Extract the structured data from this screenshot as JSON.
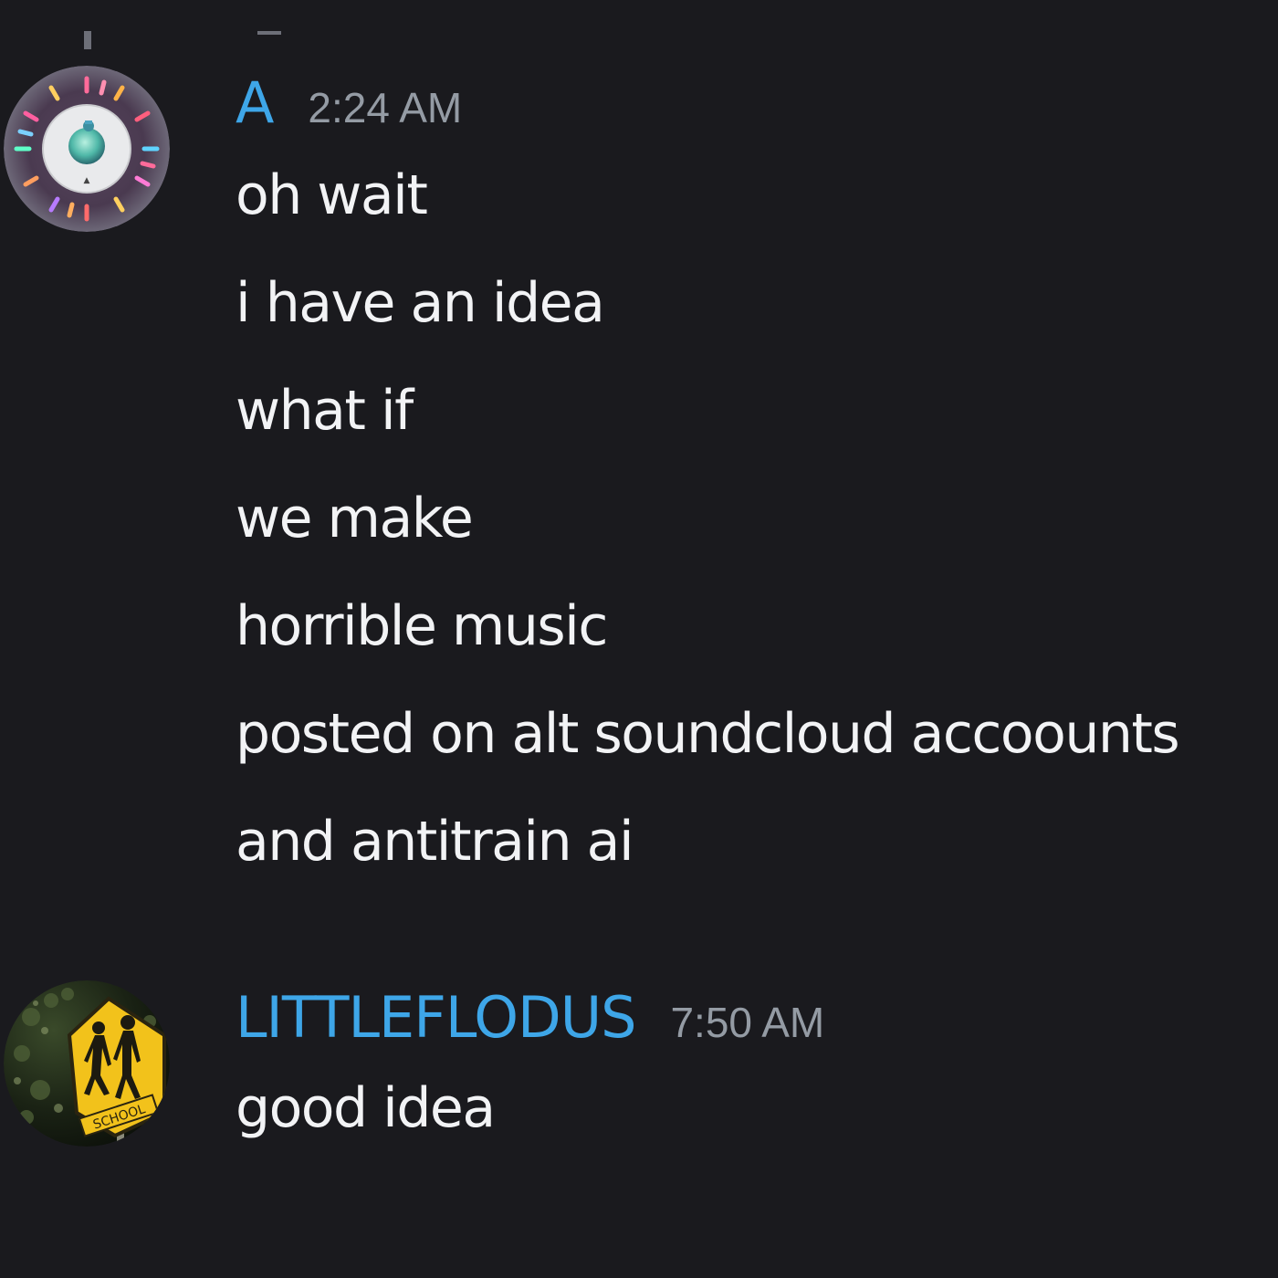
{
  "chat": {
    "messages": [
      {
        "author": "A",
        "author_color": "#3ea6e8",
        "timestamp": "2:24 AM",
        "avatar_icon": "disc-avatar-icon",
        "lines": [
          "oh wait",
          "i have an idea",
          "what if",
          "we make",
          "horrible music",
          "posted on alt soundcloud accoounts",
          "and antitrain ai"
        ]
      },
      {
        "author": "LITTLEFLODUS",
        "author_color": "#3ea6e8",
        "timestamp": "7:50 AM",
        "avatar_icon": "school-crossing-sign-avatar-icon",
        "lines": [
          "good idea"
        ]
      }
    ]
  },
  "colors": {
    "background": "#1a1a1e",
    "message_text": "#f2f3f5",
    "timestamp": "#949ba4"
  }
}
